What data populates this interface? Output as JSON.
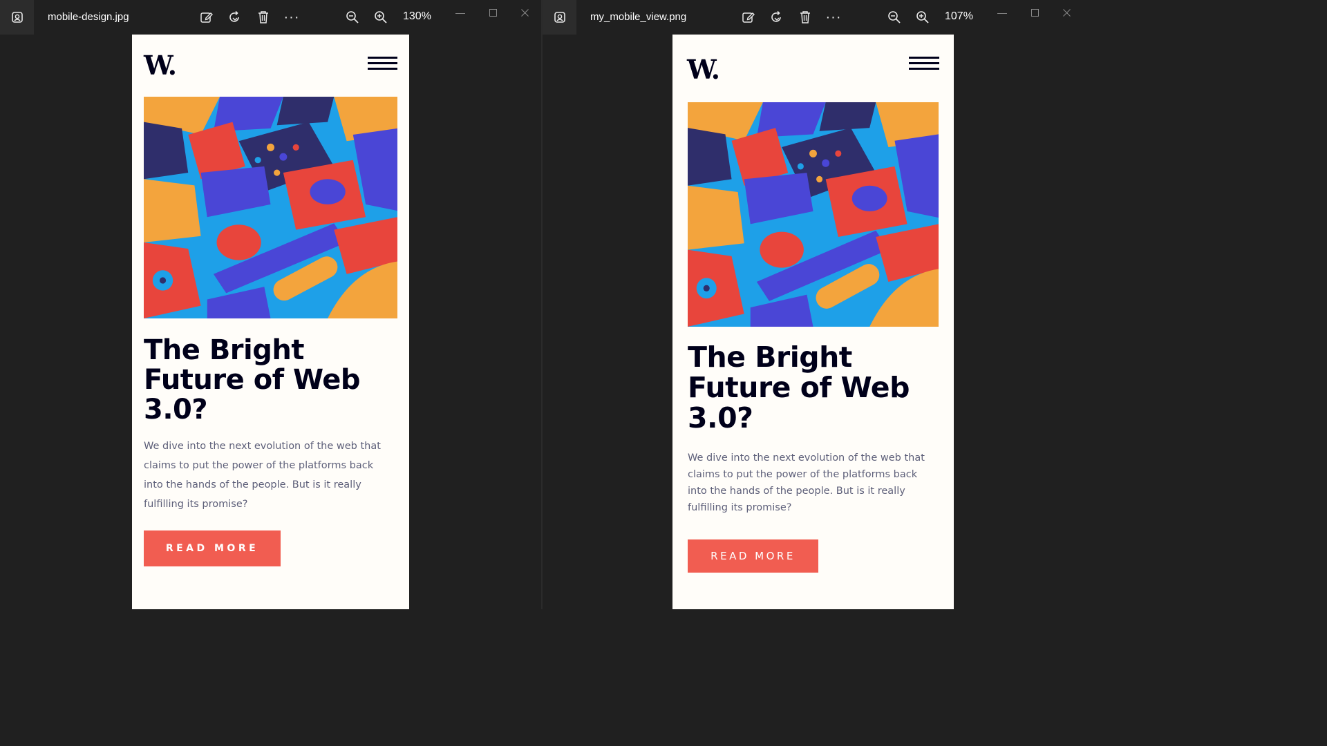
{
  "colors": {
    "window_bg": "#202020",
    "page_bg": "#fffdf9",
    "text_dark": "#00001a",
    "text_muted": "#5d5f79",
    "accent_red": "#f15d51"
  },
  "toolbar": {
    "icons": [
      "photo-app-icon",
      "edit-image-icon",
      "rotate-icon",
      "delete-icon",
      "more-icon",
      "zoom-out-icon",
      "zoom-in-icon"
    ],
    "more_label": "···"
  },
  "left_viewer": {
    "filename": "mobile-design.jpg",
    "zoom": "130%"
  },
  "right_viewer": {
    "filename": "my_mobile_view.png",
    "zoom": "107%"
  },
  "article": {
    "logo": "W.",
    "headline_line1": "The Bright",
    "headline_line2": "Future of Web",
    "headline_line3": "3.0?",
    "description_line1": "We dive into the next evolution of the web that",
    "description_line2": "claims to put the power of the platforms back",
    "description_line3": "into the hands of the people. But is it really",
    "description_line4": "fulfilling its promise?",
    "button_label": "READ MORE"
  }
}
